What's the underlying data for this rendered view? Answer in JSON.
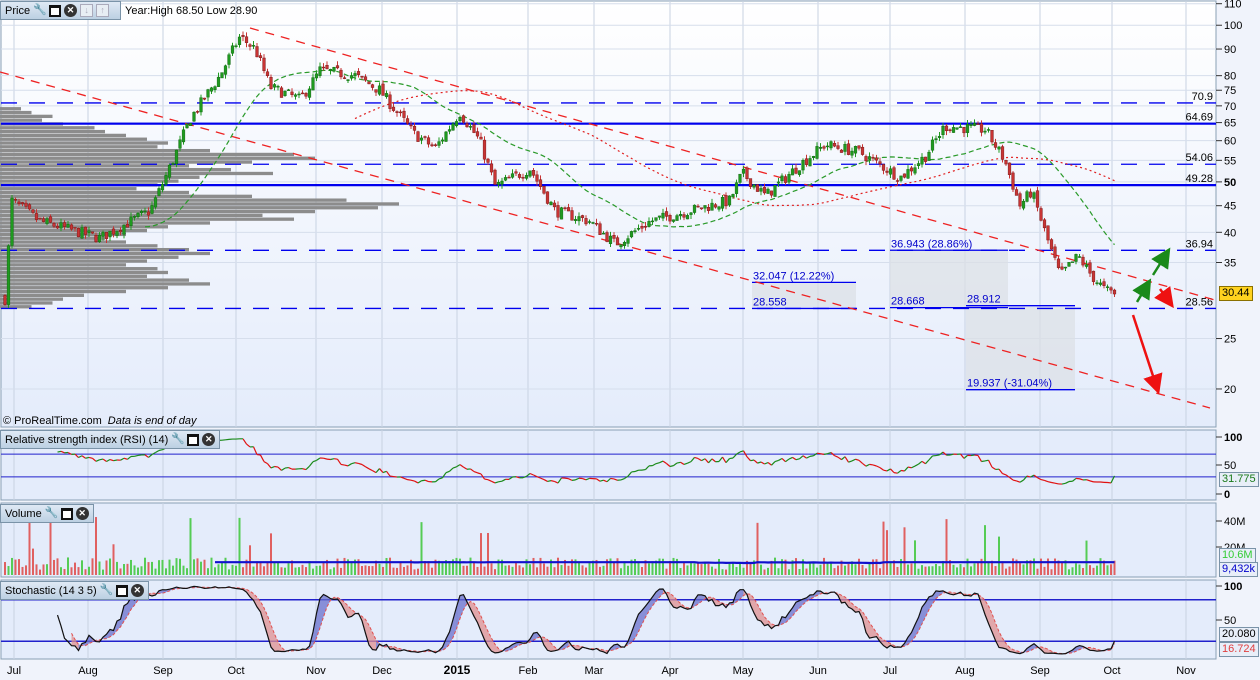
{
  "price_panel": {
    "title": "Price",
    "year_info": "Year:High 68.50 Low 28.90",
    "copyright": "© ProRealTime.com",
    "data_note": "Data is end of day",
    "last_price": "30.44"
  },
  "rsi_panel": {
    "title": "Relative strength index (RSI) (14)",
    "value": "31.775",
    "ticks": [
      "100",
      "50",
      "0"
    ]
  },
  "volume_panel": {
    "title": "Volume",
    "value": "10.6M",
    "avg_value": "9,432k",
    "ticks": [
      "40M",
      "20M"
    ]
  },
  "stoch_panel": {
    "title": "Stochastic (14 3 5)",
    "k_value": "20.080",
    "d_value": "16.724",
    "ticks": [
      "100",
      "50"
    ]
  },
  "colors": {
    "up": "#1f9a1f",
    "down": "#c83434",
    "level": "#0000ee",
    "channel": "#ee2222",
    "accent": "#ffd21f"
  },
  "chart_data": {
    "type": "candlestick",
    "title": "Price",
    "xlabel": "",
    "ylabel": "",
    "y_scale": "log",
    "ylim": [
      17,
      112
    ],
    "x_unit": "months since Jul 2014",
    "x_ticks": [
      "Jul",
      "Aug",
      "Sep",
      "Oct",
      "Nov",
      "Dec",
      "2015",
      "Feb",
      "Mar",
      "Apr",
      "May",
      "Jun",
      "Jul",
      "Aug",
      "Sep",
      "Oct",
      "Nov"
    ],
    "y_ticks": [
      "110",
      "100",
      "90",
      "80",
      "75",
      "70",
      "65",
      "60",
      "55",
      "50",
      "45",
      "40",
      "35",
      "25",
      "20"
    ],
    "price_path": [
      [
        -0.12,
        30
      ],
      [
        -0.03,
        46
      ],
      [
        0.35,
        42
      ],
      [
        1.16,
        39
      ],
      [
        1.83,
        44
      ],
      [
        2.16,
        56
      ],
      [
        2.37,
        66
      ],
      [
        2.78,
        80
      ],
      [
        3.05,
        95
      ],
      [
        3.24,
        90
      ],
      [
        3.43,
        76
      ],
      [
        3.8,
        72
      ],
      [
        4.06,
        82
      ],
      [
        4.59,
        80
      ],
      [
        4.97,
        75
      ],
      [
        5.42,
        62
      ],
      [
        5.71,
        58
      ],
      [
        6.04,
        68
      ],
      [
        6.32,
        60
      ],
      [
        6.54,
        49
      ],
      [
        7.03,
        53
      ],
      [
        7.41,
        44
      ],
      [
        7.94,
        42
      ],
      [
        8.28,
        38
      ],
      [
        8.74,
        42
      ],
      [
        9.26,
        44
      ],
      [
        9.82,
        46
      ],
      [
        9.99,
        52
      ],
      [
        10.3,
        47
      ],
      [
        10.76,
        54
      ],
      [
        11.1,
        59
      ],
      [
        11.58,
        57
      ],
      [
        12.14,
        51
      ],
      [
        12.47,
        56
      ],
      [
        12.73,
        64
      ],
      [
        13.27,
        63
      ],
      [
        13.53,
        55
      ],
      [
        13.73,
        45
      ],
      [
        13.89,
        48
      ],
      [
        14.07,
        40
      ],
      [
        14.28,
        33
      ],
      [
        14.53,
        36
      ],
      [
        14.72,
        33
      ],
      [
        14.9,
        31
      ],
      [
        15.04,
        30.44
      ]
    ],
    "levels": [
      {
        "value": 70.9,
        "label": "70.9",
        "style": "dashed"
      },
      {
        "value": 64.69,
        "label": "64.69",
        "style": "solid"
      },
      {
        "value": 54.06,
        "label": "54.06",
        "style": "dashed"
      },
      {
        "value": 49.28,
        "label": "49.28",
        "style": "solid"
      },
      {
        "value": 36.94,
        "label": "36.94",
        "style": "dashed"
      },
      {
        "value": 28.56,
        "label": "28.56",
        "style": "dashed"
      }
    ],
    "annotations": [
      {
        "label": "32.047 (12.22%)",
        "value": 32.047
      },
      {
        "label": "28.558",
        "value": 28.558
      },
      {
        "label": "36.943 (28.86%)",
        "value": 36.943
      },
      {
        "label": "28.668",
        "value": 28.668
      },
      {
        "label": "28.912",
        "value": 28.912
      },
      {
        "label": "19.937 (-31.04%)",
        "value": 19.937
      }
    ],
    "volume_profile": [
      0,
      0,
      2,
      3,
      5,
      4,
      6,
      9,
      10,
      12,
      14,
      16,
      15,
      20,
      28,
      30,
      24,
      18,
      22,
      26,
      19,
      17,
      15,
      13,
      18,
      24,
      33,
      38,
      36,
      30,
      25,
      28,
      20,
      16,
      14,
      12,
      10,
      12,
      15,
      18,
      20,
      17,
      14,
      12,
      15,
      16,
      14,
      18,
      20,
      16,
      12,
      8,
      6,
      5,
      3
    ],
    "rsi_last": 31.775,
    "stoch_k_last": 20.08,
    "stoch_d_last": 16.724,
    "volume_last_M": 10.6,
    "volume_avg_k": 9432
  }
}
